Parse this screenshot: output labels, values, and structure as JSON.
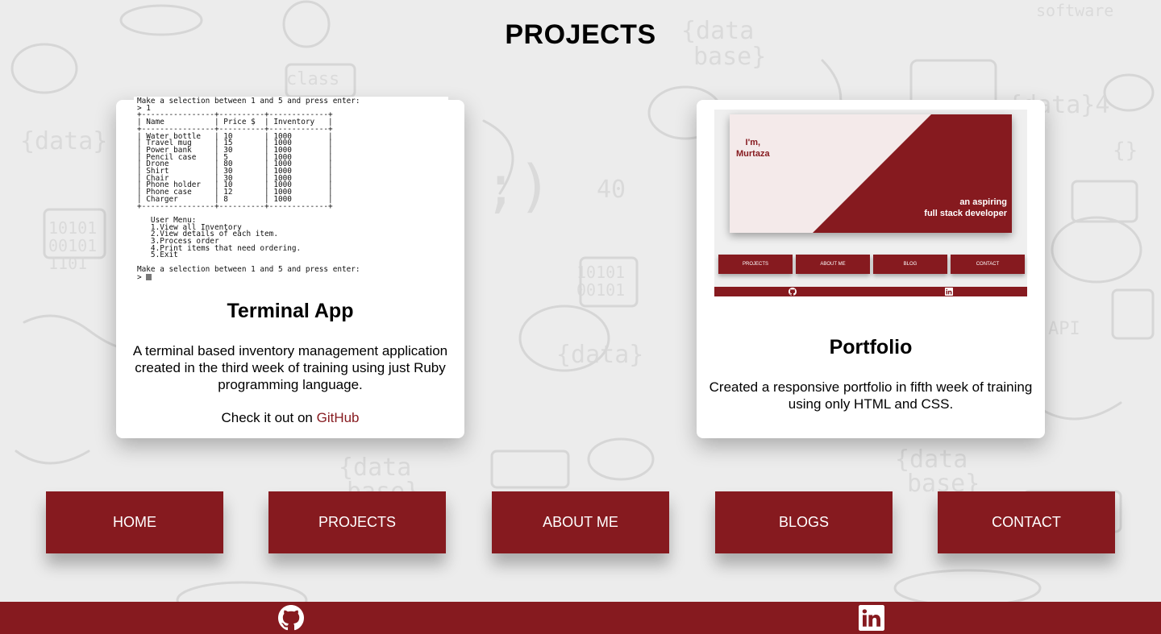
{
  "page": {
    "title": "PROJECTS"
  },
  "colors": {
    "accent": "#861a1f",
    "card": "#ffffff",
    "background": "#ececec",
    "link": "#861a1f"
  },
  "projects": [
    {
      "title": "Terminal App",
      "description": "A terminal based inventory management application created in the third week of training using just Ruby programming language.",
      "link_prefix": "Check it out on ",
      "link_text": "GitHub",
      "screenshot": {
        "prompt_top": "Make a selection between 1 and 5 and press enter:",
        "input_top": "> 1",
        "table_rule": "+----------------+----------+-------------+",
        "table_header": "| Name           | Price $  | Inventory   |",
        "rows": [
          "| Water bottle   | 10       | 1000        |",
          "| Travel mug     | 15       | 1000        |",
          "| Power bank     | 30       | 1000        |",
          "| Pencil case    | 5        | 1000        |",
          "| Drone          | 80       | 1000        |",
          "| Shirt          | 30       | 1000        |",
          "| Chair          | 30       | 1000        |",
          "| Phone holder   | 10       | 1000        |",
          "| Phone case     | 12       | 1000        |",
          "| Charger        | 8        | 1000        |"
        ],
        "menu_title": "   User Menu:",
        "menu_items": [
          "   1.View all Inventory",
          "   2.View details of each item.",
          "   3.Process order",
          "   4.Print items that need ordering.",
          "   5.Exit"
        ],
        "prompt_bottom": "Make a selection between 1 and 5 and press enter:",
        "input_bottom": "> "
      }
    },
    {
      "title": "Portfolio",
      "description": "Created a responsive portfolio in fifth week of training using only HTML and CSS.",
      "screenshot": {
        "greeting": "I'm,",
        "name": "Murtaza",
        "role_line1": "an aspiring",
        "role_line2": "full stack developer",
        "nav": [
          "PROJECTS",
          "ABOUT ME",
          "BLOG",
          "CONTACT"
        ],
        "footer_icons": [
          "github-icon",
          "linkedin-icon"
        ]
      }
    }
  ],
  "nav": [
    {
      "label": "HOME"
    },
    {
      "label": "PROJECTS"
    },
    {
      "label": "ABOUT ME"
    },
    {
      "label": "BLOGS"
    },
    {
      "label": "CONTACT"
    }
  ],
  "footer": {
    "icons": [
      "github-icon",
      "linkedin-icon"
    ]
  }
}
